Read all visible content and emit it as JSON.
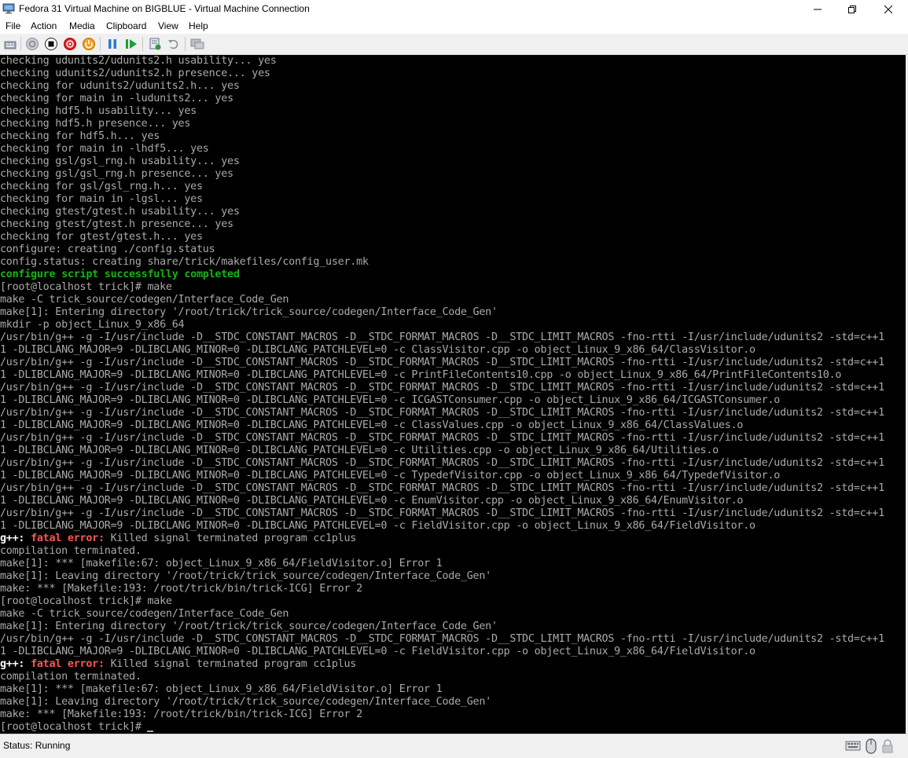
{
  "window": {
    "title": "Fedora 31 Virtual Machine on BIGBLUE - Virtual Machine Connection"
  },
  "menu": [
    "File",
    "Action",
    "Media",
    "Clipboard",
    "View",
    "Help"
  ],
  "toolbar": {
    "buttons": [
      "ctrl-alt-del",
      "start",
      "turn-off",
      "shut-down",
      "save",
      "pause",
      "resume",
      "checkpoint",
      "revert",
      "enhanced-session"
    ]
  },
  "console": {
    "lines": [
      {
        "parts": [
          {
            "t": "checking udunits2/udunits2.h usability... yes"
          }
        ]
      },
      {
        "parts": [
          {
            "t": "checking udunits2/udunits2.h presence... yes"
          }
        ]
      },
      {
        "parts": [
          {
            "t": "checking for udunits2/udunits2.h... yes"
          }
        ]
      },
      {
        "parts": [
          {
            "t": "checking for main in -ludunits2... yes"
          }
        ]
      },
      {
        "parts": [
          {
            "t": "checking hdf5.h usability... yes"
          }
        ]
      },
      {
        "parts": [
          {
            "t": "checking hdf5.h presence... yes"
          }
        ]
      },
      {
        "parts": [
          {
            "t": "checking for hdf5.h... yes"
          }
        ]
      },
      {
        "parts": [
          {
            "t": "checking for main in -lhdf5... yes"
          }
        ]
      },
      {
        "parts": [
          {
            "t": "checking gsl/gsl_rng.h usability... yes"
          }
        ]
      },
      {
        "parts": [
          {
            "t": "checking gsl/gsl_rng.h presence... yes"
          }
        ]
      },
      {
        "parts": [
          {
            "t": "checking for gsl/gsl_rng.h... yes"
          }
        ]
      },
      {
        "parts": [
          {
            "t": "checking for main in -lgsl... yes"
          }
        ]
      },
      {
        "parts": [
          {
            "t": "checking gtest/gtest.h usability... yes"
          }
        ]
      },
      {
        "parts": [
          {
            "t": "checking gtest/gtest.h presence... yes"
          }
        ]
      },
      {
        "parts": [
          {
            "t": "checking for gtest/gtest.h... yes"
          }
        ]
      },
      {
        "parts": [
          {
            "t": "configure: creating ./config.status"
          }
        ]
      },
      {
        "parts": [
          {
            "t": "config.status: creating share/trick/makefiles/config_user.mk"
          }
        ]
      },
      {
        "parts": [
          {
            "t": "configure script successfully completed",
            "c": "green"
          }
        ]
      },
      {
        "parts": [
          {
            "t": "[root@localhost trick]# make"
          }
        ]
      },
      {
        "parts": [
          {
            "t": "make -C trick_source/codegen/Interface_Code_Gen"
          }
        ]
      },
      {
        "parts": [
          {
            "t": "make[1]: Entering directory '/root/trick/trick_source/codegen/Interface_Code_Gen'"
          }
        ]
      },
      {
        "parts": [
          {
            "t": "mkdir -p object_Linux_9_x86_64"
          }
        ]
      },
      {
        "parts": [
          {
            "t": "/usr/bin/g++ -g -I/usr/include -D__STDC_CONSTANT_MACROS -D__STDC_FORMAT_MACROS -D__STDC_LIMIT_MACROS -fno-rtti -I/usr/include/udunits2 -std=c++1"
          }
        ]
      },
      {
        "parts": [
          {
            "t": "1 -DLIBCLANG_MAJOR=9 -DLIBCLANG_MINOR=0 -DLIBCLANG_PATCHLEVEL=0 -c ClassVisitor.cpp -o object_Linux_9_x86_64/ClassVisitor.o"
          }
        ]
      },
      {
        "parts": [
          {
            "t": "/usr/bin/g++ -g -I/usr/include -D__STDC_CONSTANT_MACROS -D__STDC_FORMAT_MACROS -D__STDC_LIMIT_MACROS -fno-rtti -I/usr/include/udunits2 -std=c++1"
          }
        ]
      },
      {
        "parts": [
          {
            "t": "1 -DLIBCLANG_MAJOR=9 -DLIBCLANG_MINOR=0 -DLIBCLANG_PATCHLEVEL=0 -c PrintFileContents10.cpp -o object_Linux_9_x86_64/PrintFileContents10.o"
          }
        ]
      },
      {
        "parts": [
          {
            "t": "/usr/bin/g++ -g -I/usr/include -D__STDC_CONSTANT_MACROS -D__STDC_FORMAT_MACROS -D__STDC_LIMIT_MACROS -fno-rtti -I/usr/include/udunits2 -std=c++1"
          }
        ]
      },
      {
        "parts": [
          {
            "t": "1 -DLIBCLANG_MAJOR=9 -DLIBCLANG_MINOR=0 -DLIBCLANG_PATCHLEVEL=0 -c ICGASTConsumer.cpp -o object_Linux_9_x86_64/ICGASTConsumer.o"
          }
        ]
      },
      {
        "parts": [
          {
            "t": "/usr/bin/g++ -g -I/usr/include -D__STDC_CONSTANT_MACROS -D__STDC_FORMAT_MACROS -D__STDC_LIMIT_MACROS -fno-rtti -I/usr/include/udunits2 -std=c++1"
          }
        ]
      },
      {
        "parts": [
          {
            "t": "1 -DLIBCLANG_MAJOR=9 -DLIBCLANG_MINOR=0 -DLIBCLANG_PATCHLEVEL=0 -c ClassValues.cpp -o object_Linux_9_x86_64/ClassValues.o"
          }
        ]
      },
      {
        "parts": [
          {
            "t": "/usr/bin/g++ -g -I/usr/include -D__STDC_CONSTANT_MACROS -D__STDC_FORMAT_MACROS -D__STDC_LIMIT_MACROS -fno-rtti -I/usr/include/udunits2 -std=c++1"
          }
        ]
      },
      {
        "parts": [
          {
            "t": "1 -DLIBCLANG_MAJOR=9 -DLIBCLANG_MINOR=0 -DLIBCLANG_PATCHLEVEL=0 -c Utilities.cpp -o object_Linux_9_x86_64/Utilities.o"
          }
        ]
      },
      {
        "parts": [
          {
            "t": "/usr/bin/g++ -g -I/usr/include -D__STDC_CONSTANT_MACROS -D__STDC_FORMAT_MACROS -D__STDC_LIMIT_MACROS -fno-rtti -I/usr/include/udunits2 -std=c++1"
          }
        ]
      },
      {
        "parts": [
          {
            "t": "1 -DLIBCLANG_MAJOR=9 -DLIBCLANG_MINOR=0 -DLIBCLANG_PATCHLEVEL=0 -c TypedefVisitor.cpp -o object_Linux_9_x86_64/TypedefVisitor.o"
          }
        ]
      },
      {
        "parts": [
          {
            "t": "/usr/bin/g++ -g -I/usr/include -D__STDC_CONSTANT_MACROS -D__STDC_FORMAT_MACROS -D__STDC_LIMIT_MACROS -fno-rtti -I/usr/include/udunits2 -std=c++1"
          }
        ]
      },
      {
        "parts": [
          {
            "t": "1 -DLIBCLANG_MAJOR=9 -DLIBCLANG_MINOR=0 -DLIBCLANG_PATCHLEVEL=0 -c EnumVisitor.cpp -o object_Linux_9_x86_64/EnumVisitor.o"
          }
        ]
      },
      {
        "parts": [
          {
            "t": "/usr/bin/g++ -g -I/usr/include -D__STDC_CONSTANT_MACROS -D__STDC_FORMAT_MACROS -D__STDC_LIMIT_MACROS -fno-rtti -I/usr/include/udunits2 -std=c++1"
          }
        ]
      },
      {
        "parts": [
          {
            "t": "1 -DLIBCLANG_MAJOR=9 -DLIBCLANG_MINOR=0 -DLIBCLANG_PATCHLEVEL=0 -c FieldVisitor.cpp -o object_Linux_9_x86_64/FieldVisitor.o"
          }
        ]
      },
      {
        "parts": [
          {
            "t": "g++: ",
            "c": "bold"
          },
          {
            "t": "fatal error: ",
            "c": "red"
          },
          {
            "t": "Killed signal terminated program cc1plus"
          }
        ]
      },
      {
        "parts": [
          {
            "t": "compilation terminated."
          }
        ]
      },
      {
        "parts": [
          {
            "t": "make[1]: *** [makefile:67: object_Linux_9_x86_64/FieldVisitor.o] Error 1"
          }
        ]
      },
      {
        "parts": [
          {
            "t": "make[1]: Leaving directory '/root/trick/trick_source/codegen/Interface_Code_Gen'"
          }
        ]
      },
      {
        "parts": [
          {
            "t": "make: *** [Makefile:193: /root/trick/bin/trick-ICG] Error 2"
          }
        ]
      },
      {
        "parts": [
          {
            "t": "[root@localhost trick]# make"
          }
        ]
      },
      {
        "parts": [
          {
            "t": "make -C trick_source/codegen/Interface_Code_Gen"
          }
        ]
      },
      {
        "parts": [
          {
            "t": "make[1]: Entering directory '/root/trick/trick_source/codegen/Interface_Code_Gen'"
          }
        ]
      },
      {
        "parts": [
          {
            "t": "/usr/bin/g++ -g -I/usr/include -D__STDC_CONSTANT_MACROS -D__STDC_FORMAT_MACROS -D__STDC_LIMIT_MACROS -fno-rtti -I/usr/include/udunits2 -std=c++1"
          }
        ]
      },
      {
        "parts": [
          {
            "t": "1 -DLIBCLANG_MAJOR=9 -DLIBCLANG_MINOR=0 -DLIBCLANG_PATCHLEVEL=0 -c FieldVisitor.cpp -o object_Linux_9_x86_64/FieldVisitor.o"
          }
        ]
      },
      {
        "parts": [
          {
            "t": "g++: ",
            "c": "bold"
          },
          {
            "t": "fatal error: ",
            "c": "red"
          },
          {
            "t": "Killed signal terminated program cc1plus"
          }
        ]
      },
      {
        "parts": [
          {
            "t": "compilation terminated."
          }
        ]
      },
      {
        "parts": [
          {
            "t": "make[1]: *** [makefile:67: object_Linux_9_x86_64/FieldVisitor.o] Error 1"
          }
        ]
      },
      {
        "parts": [
          {
            "t": "make[1]: Leaving directory '/root/trick/trick_source/codegen/Interface_Code_Gen'"
          }
        ]
      },
      {
        "parts": [
          {
            "t": "make: *** [Makefile:193: /root/trick/bin/trick-ICG] Error 2"
          }
        ]
      },
      {
        "parts": [
          {
            "t": "[root@localhost trick]# "
          }
        ],
        "cursor": true
      }
    ]
  },
  "status": {
    "text": "Status: Running"
  }
}
